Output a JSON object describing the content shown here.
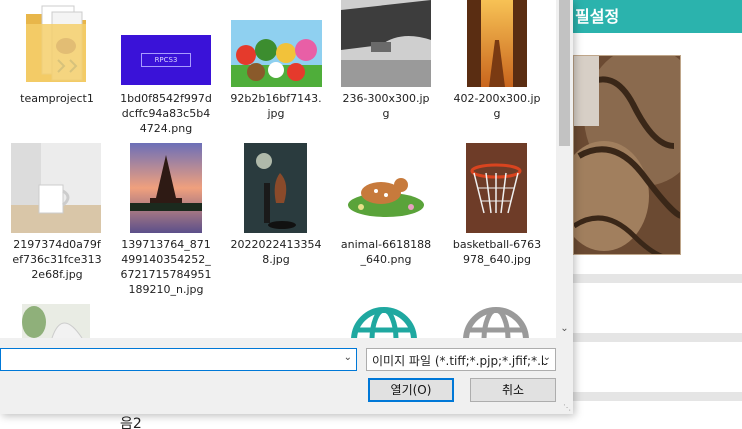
{
  "background_page": {
    "header_text": "필설정",
    "bottom_text": "음2"
  },
  "dialog": {
    "files": [
      {
        "name": "teamproject1",
        "type": "folder"
      },
      {
        "name": "1bd0f8542f997dcffc94a83c5b44724.png",
        "label_lines": [
          "1bd0f8542f997d",
          "dcffc94a83c5b4",
          "4724.png"
        ],
        "thumb_text": "RPCS3"
      },
      {
        "name": "92b2b16bf7143.jpg",
        "label_lines": [
          "92b2b16bf7143.",
          "jpg"
        ]
      },
      {
        "name": "236-300x300.jpg",
        "label_lines": [
          "236-300x300.jp",
          "g"
        ]
      },
      {
        "name": "402-200x300.jpg",
        "label_lines": [
          "402-200x300.jp",
          "g"
        ]
      },
      {
        "name": "2197374d0a79fef736c31fce3132e68f.jpg",
        "label_lines": [
          "2197374d0a79f",
          "ef736c31fce313",
          "2e68f.jpg"
        ]
      },
      {
        "name": "139713764_871499140354252_6721715784951189210_n.jpg",
        "label_lines": [
          "139713764_871",
          "499140354252_",
          "6721715784951",
          "189210_n.jpg"
        ]
      },
      {
        "name": "20220224133548.jpg",
        "label_lines": [
          "2022022413354",
          "8.jpg"
        ]
      },
      {
        "name": "animal-6618188_640.png",
        "label_lines": [
          "animal-6618188",
          "_640.png"
        ]
      },
      {
        "name": "basketball-6763978_640.jpg",
        "label_lines": [
          "basketball-6763",
          "978_640.jpg"
        ]
      }
    ],
    "filename_value": "",
    "filter_label": "이미지 파일 (*.tiff;*.pjp;*.jfif;*.b",
    "open_button": "열기(O)",
    "cancel_button": "취소"
  },
  "colors": {
    "accent": "#2bb3ad",
    "focus_blue": "#0078d7",
    "dialog_panel": "#f0f0f0"
  }
}
